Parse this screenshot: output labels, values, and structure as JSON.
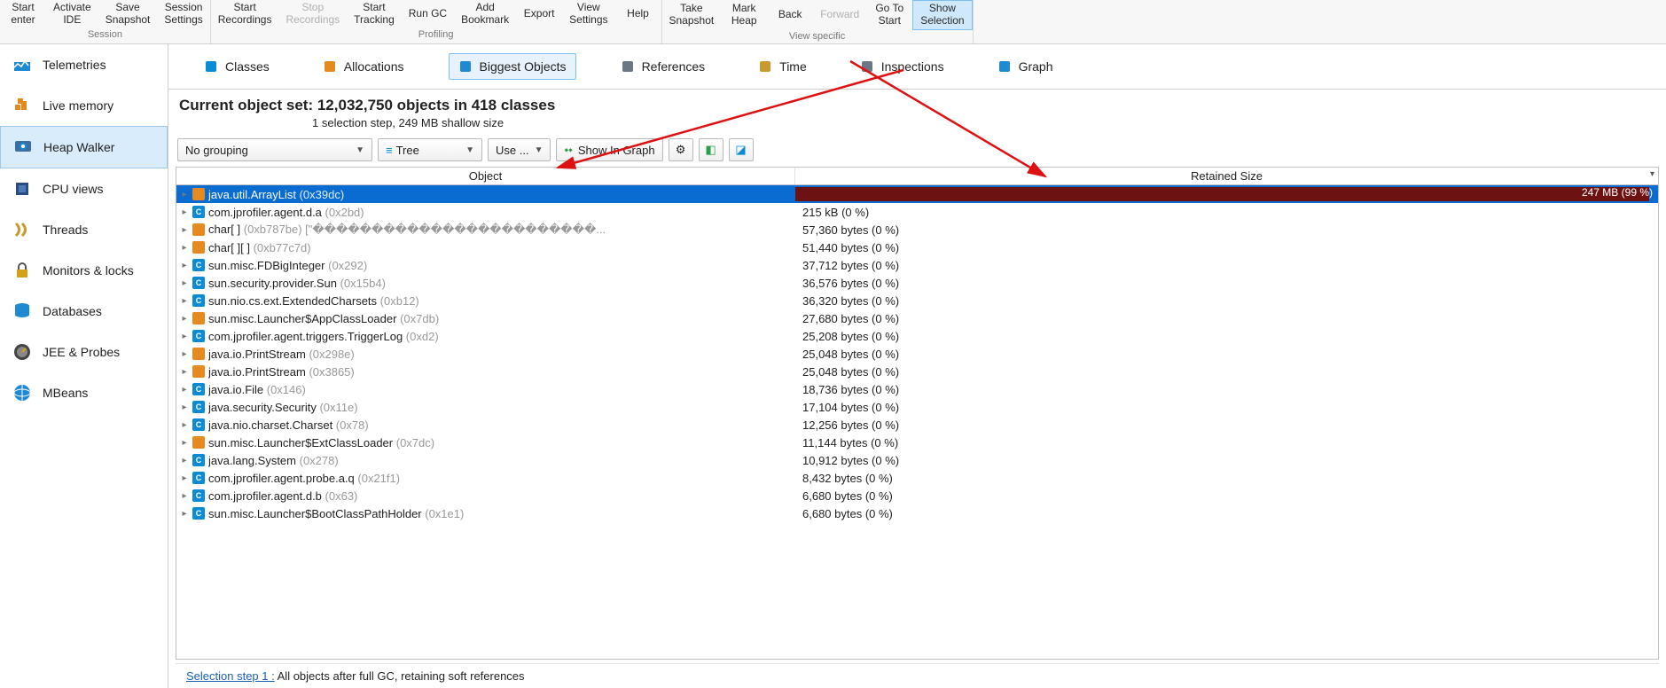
{
  "ribbon": {
    "groups": [
      {
        "label": "Session",
        "items": [
          {
            "l1": "Start",
            "l2": "enter"
          },
          {
            "l1": "Activate",
            "l2": "IDE"
          },
          {
            "l1": "Save",
            "l2": "Snapshot"
          },
          {
            "l1": "Session",
            "l2": "Settings"
          }
        ]
      },
      {
        "label": "Profiling",
        "items": [
          {
            "l1": "Start",
            "l2": "Recordings"
          },
          {
            "l1": "Stop",
            "l2": "Recordings",
            "disabled": true
          },
          {
            "l1": "Start",
            "l2": "Tracking"
          },
          {
            "l1": "Run GC",
            "l2": ""
          },
          {
            "l1": "Add",
            "l2": "Bookmark"
          },
          {
            "l1": "Export",
            "l2": ""
          },
          {
            "l1": "View",
            "l2": "Settings"
          },
          {
            "l1": "Help",
            "l2": ""
          }
        ]
      },
      {
        "label": "View specific",
        "items": [
          {
            "l1": "Take",
            "l2": "Snapshot"
          },
          {
            "l1": "Mark",
            "l2": "Heap"
          },
          {
            "l1": "Back",
            "l2": ""
          },
          {
            "l1": "Forward",
            "l2": "",
            "disabled": true
          },
          {
            "l1": "Go To",
            "l2": "Start"
          },
          {
            "l1": "Show",
            "l2": "Selection",
            "active": true
          }
        ]
      }
    ]
  },
  "sidebar": {
    "items": [
      {
        "label": "Telemetries",
        "icon": "telemetry"
      },
      {
        "label": "Live memory",
        "icon": "memory"
      },
      {
        "label": "Heap Walker",
        "icon": "heap",
        "selected": true
      },
      {
        "label": "CPU views",
        "icon": "cpu"
      },
      {
        "label": "Threads",
        "icon": "threads"
      },
      {
        "label": "Monitors & locks",
        "icon": "lock"
      },
      {
        "label": "Databases",
        "icon": "db"
      },
      {
        "label": "JEE & Probes",
        "icon": "probe"
      },
      {
        "label": "MBeans",
        "icon": "globe"
      }
    ]
  },
  "tabs": {
    "items": [
      {
        "label": "Classes",
        "icon": "class"
      },
      {
        "label": "Allocations",
        "icon": "alloc"
      },
      {
        "label": "Biggest Objects",
        "icon": "biggest",
        "selected": true
      },
      {
        "label": "References",
        "icon": "ref"
      },
      {
        "label": "Time",
        "icon": "clock"
      },
      {
        "label": "Inspections",
        "icon": "gear"
      },
      {
        "label": "Graph",
        "icon": "graph"
      }
    ]
  },
  "subheader": {
    "title": "Current object set:  12,032,750 objects in 418 classes",
    "sub": "1 selection step, 249 MB shallow size"
  },
  "controls": {
    "grouping": "No grouping",
    "tree": "Tree",
    "use": "Use ...",
    "showgraph": "Show In Graph"
  },
  "table": {
    "col_object": "Object",
    "col_retained": "Retained Size",
    "rows": [
      {
        "icon": "obj",
        "name": "java.util.ArrayList",
        "addr": "(0x39dc)",
        "size": "247 MB (99 %)",
        "bar": 99,
        "selected": true
      },
      {
        "icon": "cls",
        "name": "com.jprofiler.agent.d.a",
        "addr": "(0x2bd)",
        "size": "215 kB (0 %)"
      },
      {
        "icon": "obj",
        "name": "char[ ]",
        "addr": "(0xb787be) [\"������������������������...",
        "size": "57,360 bytes (0 %)"
      },
      {
        "icon": "obj",
        "name": "char[ ][ ]",
        "addr": "(0xb77c7d)",
        "size": "51,440 bytes (0 %)"
      },
      {
        "icon": "cls",
        "name": "sun.misc.FDBigInteger",
        "addr": "(0x292)",
        "size": "37,712 bytes (0 %)"
      },
      {
        "icon": "cls",
        "name": "sun.security.provider.Sun",
        "addr": "(0x15b4)",
        "size": "36,576 bytes (0 %)"
      },
      {
        "icon": "cls",
        "name": "sun.nio.cs.ext.ExtendedCharsets",
        "addr": "(0xb12)",
        "size": "36,320 bytes (0 %)"
      },
      {
        "icon": "obj",
        "name": "sun.misc.Launcher$AppClassLoader",
        "addr": "(0x7db)",
        "size": "27,680 bytes (0 %)"
      },
      {
        "icon": "cls",
        "name": "com.jprofiler.agent.triggers.TriggerLog",
        "addr": "(0xd2)",
        "size": "25,208 bytes (0 %)"
      },
      {
        "icon": "obj",
        "name": "java.io.PrintStream",
        "addr": "(0x298e)",
        "size": "25,048 bytes (0 %)"
      },
      {
        "icon": "obj",
        "name": "java.io.PrintStream",
        "addr": "(0x3865)",
        "size": "25,048 bytes (0 %)"
      },
      {
        "icon": "cls",
        "name": "java.io.File",
        "addr": "(0x146)",
        "size": "18,736 bytes (0 %)"
      },
      {
        "icon": "cls",
        "name": "java.security.Security",
        "addr": "(0x11e)",
        "size": "17,104 bytes (0 %)"
      },
      {
        "icon": "cls",
        "name": "java.nio.charset.Charset",
        "addr": "(0x78)",
        "size": "12,256 bytes (0 %)"
      },
      {
        "icon": "obj",
        "name": "sun.misc.Launcher$ExtClassLoader",
        "addr": "(0x7dc)",
        "size": "11,144 bytes (0 %)"
      },
      {
        "icon": "cls",
        "name": "java.lang.System",
        "addr": "(0x278)",
        "size": "10,912 bytes (0 %)"
      },
      {
        "icon": "cls",
        "name": "com.jprofiler.agent.probe.a.q",
        "addr": "(0x21f1)",
        "size": "8,432 bytes (0 %)"
      },
      {
        "icon": "cls",
        "name": "com.jprofiler.agent.d.b",
        "addr": "(0x63)",
        "size": "6,680 bytes (0 %)"
      },
      {
        "icon": "cls",
        "name": "sun.misc.Launcher$BootClassPathHolder",
        "addr": "(0x1e1)",
        "size": "6,680 bytes (0 %)"
      }
    ]
  },
  "footer": {
    "link": "Selection step 1 :",
    "text": " All objects after full GC, retaining soft references"
  }
}
